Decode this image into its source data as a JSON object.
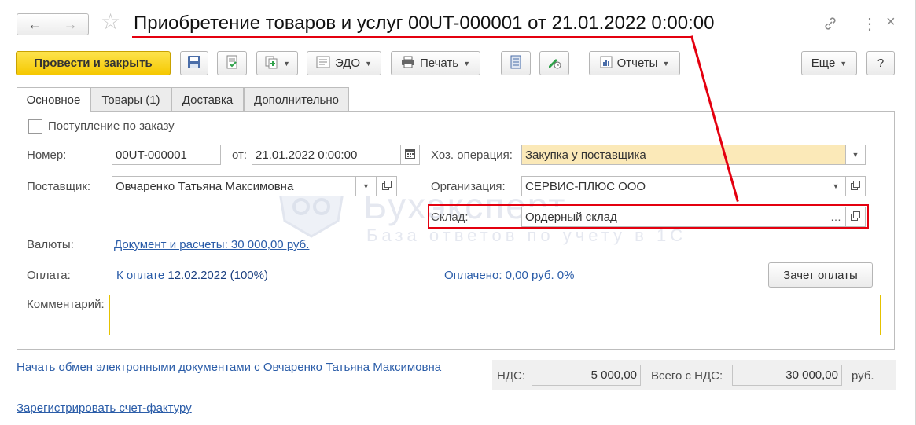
{
  "window": {
    "title": "Приобретение товаров и услуг 00UT-000001 от 21.01.2022 0:00:00",
    "nav_back": "←",
    "nav_forward": "→",
    "star": "☆",
    "link_icon": "link-icon",
    "more_icon": "⋮",
    "close": "×"
  },
  "toolbar": {
    "post_close": "Провести и закрыть",
    "edo": "ЭДО",
    "print": "Печать",
    "reports": "Отчеты",
    "more": "Еще",
    "help": "?"
  },
  "tabs": [
    {
      "label": "Основное"
    },
    {
      "label": "Товары (1)"
    },
    {
      "label": "Доставка"
    },
    {
      "label": "Дополнительно"
    }
  ],
  "form": {
    "by_order_label": "Поступление по заказу",
    "number_label": "Номер:",
    "number_value": "00UT-000001",
    "date_label": "от:",
    "date_value": "21.01.2022  0:00:00",
    "supplier_label": "Поставщик:",
    "supplier_value": "Овчаренко Татьяна Максимовна",
    "operation_label": "Хоз. операция:",
    "operation_value": "Закупка у поставщика",
    "org_label": "Организация:",
    "org_value": "СЕРВИС-ПЛЮС ООО",
    "warehouse_label": "Склад:",
    "warehouse_value": "Ордерный склад",
    "currency_label": "Валюты:",
    "currency_link": "Документ и расчеты: 30 000,00 руб.",
    "payment_label": "Оплата:",
    "payment_link_prefix": "К оплате",
    "payment_link_date": "12.02.2022 (100%)",
    "paid_link": "Оплачено: 0,00 руб. 0%",
    "offset_button": "Зачет оплаты",
    "comment_label": "Комментарий:",
    "comment_value": ""
  },
  "watermark": {
    "line1": "Бухэксперт",
    "line2": "База ответов по учету в 1С"
  },
  "footer": {
    "edo_link": "Начать обмен электронными документами с Овчаренко Татьяна Максимовна",
    "invoice_link": "Зарегистрировать счет-фактуру",
    "vat_label": "НДС:",
    "vat_value": "5 000,00",
    "total_label": "Всего с НДС:",
    "total_value": "30 000,00",
    "currency": "руб."
  },
  "colors": {
    "accent_red": "#e4000f",
    "primary_button": "#f5c800",
    "link": "#2a5ca8",
    "highlight_field": "#fbe9b8"
  }
}
